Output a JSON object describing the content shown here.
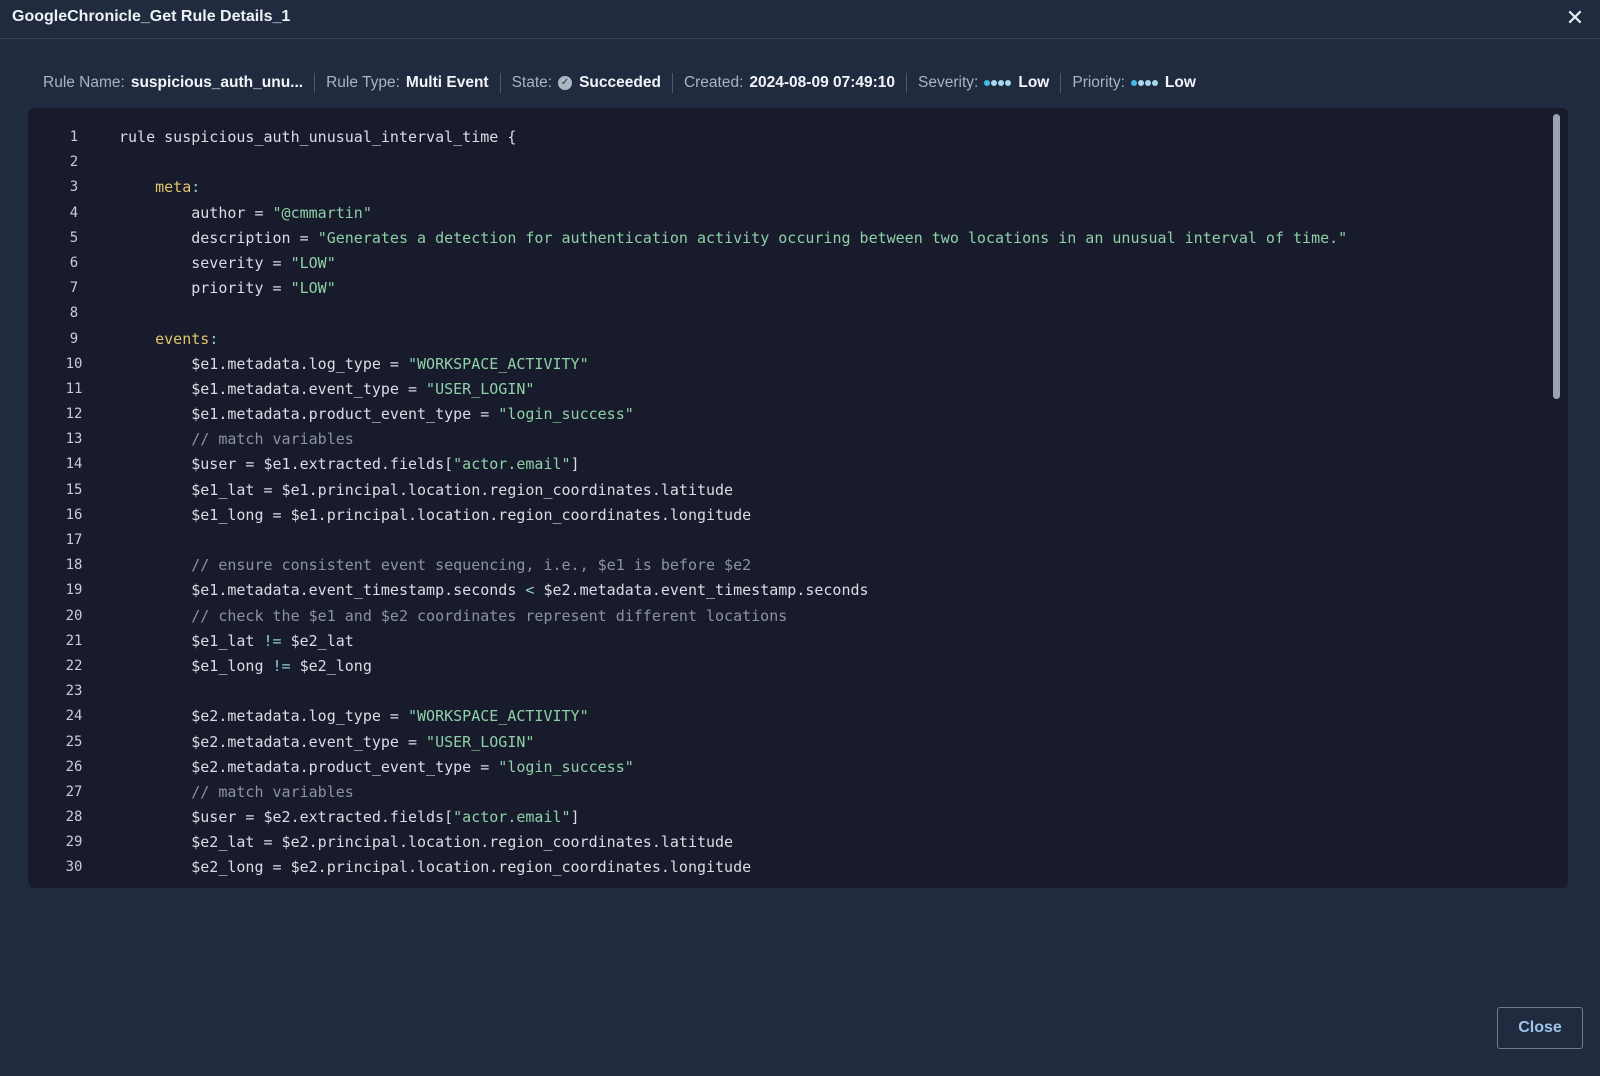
{
  "window": {
    "title": "GoogleChronicle_Get Rule Details_1",
    "close_icon": "close-icon"
  },
  "meta": {
    "rule_name_label": "Rule Name:",
    "rule_name_value": "suspicious_auth_unu...",
    "rule_type_label": "Rule Type:",
    "rule_type_value": "Multi Event",
    "state_label": "State:",
    "state_value": "Succeeded",
    "created_label": "Created:",
    "created_value": "2024-08-09 07:49:10",
    "severity_label": "Severity:",
    "severity_value": "Low",
    "priority_label": "Priority:",
    "priority_value": "Low"
  },
  "code_lines": [
    [
      {
        "t": "rule suspicious_auth_unusual_interval_time {",
        "c": ""
      }
    ],
    [],
    [
      {
        "t": "    ",
        "c": ""
      },
      {
        "t": "meta",
        "c": "kw"
      },
      {
        "t": ":",
        "c": "op"
      }
    ],
    [
      {
        "t": "        author = ",
        "c": ""
      },
      {
        "t": "\"@cmmartin\"",
        "c": "str"
      }
    ],
    [
      {
        "t": "        description = ",
        "c": ""
      },
      {
        "t": "\"Generates a detection for authentication activity occuring between two locations in an unusual interval of time.\"",
        "c": "str"
      }
    ],
    [
      {
        "t": "        severity = ",
        "c": ""
      },
      {
        "t": "\"LOW\"",
        "c": "str"
      }
    ],
    [
      {
        "t": "        priority = ",
        "c": ""
      },
      {
        "t": "\"LOW\"",
        "c": "str"
      }
    ],
    [],
    [
      {
        "t": "    ",
        "c": ""
      },
      {
        "t": "events",
        "c": "kw"
      },
      {
        "t": ":",
        "c": "op"
      }
    ],
    [
      {
        "t": "        $e1.metadata.log_type = ",
        "c": ""
      },
      {
        "t": "\"WORKSPACE_ACTIVITY\"",
        "c": "str"
      }
    ],
    [
      {
        "t": "        $e1.metadata.event_type = ",
        "c": ""
      },
      {
        "t": "\"USER_LOGIN\"",
        "c": "str"
      }
    ],
    [
      {
        "t": "        $e1.metadata.product_event_type = ",
        "c": ""
      },
      {
        "t": "\"login_success\"",
        "c": "str"
      }
    ],
    [
      {
        "t": "        // match variables",
        "c": "cmt"
      }
    ],
    [
      {
        "t": "        $user = $e1.extracted.fields[",
        "c": ""
      },
      {
        "t": "\"actor.email\"",
        "c": "str"
      },
      {
        "t": "]",
        "c": ""
      }
    ],
    [
      {
        "t": "        $e1_lat = $e1.principal.location.region_coordinates.latitude",
        "c": ""
      }
    ],
    [
      {
        "t": "        $e1_long = $e1.principal.location.region_coordinates.longitude",
        "c": ""
      }
    ],
    [],
    [
      {
        "t": "        // ensure consistent event sequencing, i.e., $e1 is before $e2",
        "c": "cmt"
      }
    ],
    [
      {
        "t": "        $e1.metadata.event_timestamp.seconds ",
        "c": ""
      },
      {
        "t": "<",
        "c": "op"
      },
      {
        "t": " $e2.metadata.event_timestamp.seconds",
        "c": ""
      }
    ],
    [
      {
        "t": "        // check the $e1 and $e2 coordinates represent different locations",
        "c": "cmt"
      }
    ],
    [
      {
        "t": "        $e1_lat ",
        "c": ""
      },
      {
        "t": "!=",
        "c": "op"
      },
      {
        "t": " $e2_lat",
        "c": ""
      }
    ],
    [
      {
        "t": "        $e1_long ",
        "c": ""
      },
      {
        "t": "!=",
        "c": "op"
      },
      {
        "t": " $e2_long",
        "c": ""
      }
    ],
    [],
    [
      {
        "t": "        $e2.metadata.log_type = ",
        "c": ""
      },
      {
        "t": "\"WORKSPACE_ACTIVITY\"",
        "c": "str"
      }
    ],
    [
      {
        "t": "        $e2.metadata.event_type = ",
        "c": ""
      },
      {
        "t": "\"USER_LOGIN\"",
        "c": "str"
      }
    ],
    [
      {
        "t": "        $e2.metadata.product_event_type = ",
        "c": ""
      },
      {
        "t": "\"login_success\"",
        "c": "str"
      }
    ],
    [
      {
        "t": "        // match variables",
        "c": "cmt"
      }
    ],
    [
      {
        "t": "        $user = $e2.extracted.fields[",
        "c": ""
      },
      {
        "t": "\"actor.email\"",
        "c": "str"
      },
      {
        "t": "]",
        "c": ""
      }
    ],
    [
      {
        "t": "        $e2_lat = $e2.principal.location.region_coordinates.latitude",
        "c": ""
      }
    ],
    [
      {
        "t": "        $e2_long = $e2.principal.location.region_coordinates.longitude",
        "c": ""
      }
    ]
  ],
  "footer": {
    "close_label": "Close"
  },
  "colors": {
    "background": "#202b40",
    "editor_background": "#181b2b",
    "keyword": "#e0c36d",
    "string": "#8ed0a8",
    "comment": "#8b93a3",
    "accent": "#46b9e8"
  }
}
